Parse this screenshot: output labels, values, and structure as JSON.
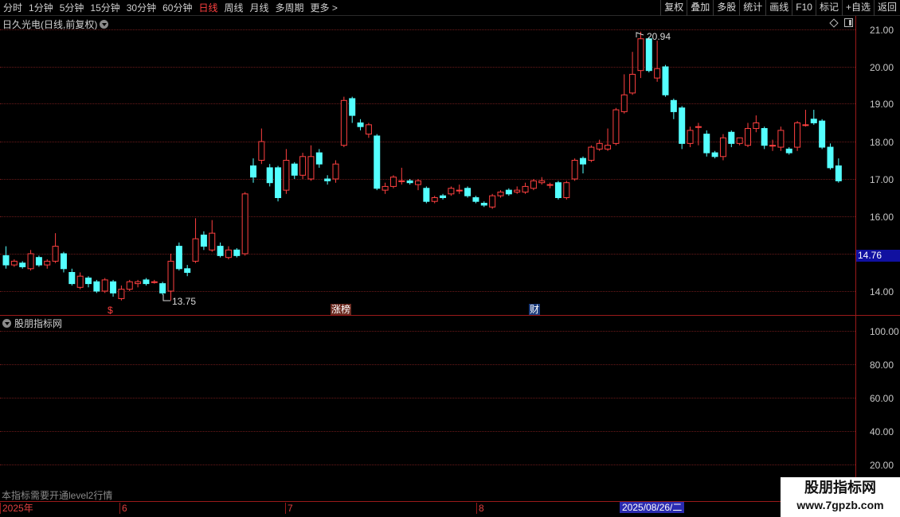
{
  "toolbar": {
    "period_tabs": [
      "分时",
      "1分钟",
      "5分钟",
      "15分钟",
      "30分钟",
      "60分钟",
      "日线",
      "周线",
      "月线",
      "多周期",
      "更多 >"
    ],
    "active_tab": "日线",
    "right_buttons": [
      "复权",
      "叠加",
      "多股",
      "统计",
      "画线",
      "F10",
      "标记",
      "+自选",
      "返回"
    ]
  },
  "main_panel": {
    "title": "日久光电(日线,前复权)",
    "y_labels": [
      "21.00",
      "20.00",
      "19.00",
      "18.00",
      "17.00",
      "16.00",
      "14.00"
    ],
    "current_price": "14.76",
    "max_annotation": "20.94",
    "min_annotation": "13.75",
    "markers": {
      "s": "$",
      "zhang": "涨榜",
      "cai": "财"
    }
  },
  "indicator_panel": {
    "title": "股朋指标网",
    "y_labels": [
      "100.00",
      "80.00",
      "60.00",
      "40.00",
      "20.00"
    ],
    "notice": "本指标需要开通level2行情"
  },
  "date_axis": {
    "labels": [
      "2025年",
      "6",
      "7",
      "8"
    ],
    "cursor_date": "2025/08/26/二"
  },
  "watermark": {
    "title": "股朋指标网",
    "url": "www.7gpzb.com"
  },
  "colors": {
    "up": "#ff4040",
    "down": "#54ffff",
    "grid": "#6a1a1a",
    "axis": "#9a1a1a",
    "active_tab": "#ff4040"
  },
  "chart_data": {
    "type": "candlestick",
    "y_range": [
      13.5,
      21.3
    ],
    "y_ticks": [
      14,
      15,
      16,
      17,
      18,
      19,
      20,
      21
    ],
    "candles": [
      [
        14.95,
        14.7,
        15.2,
        14.6
      ],
      [
        14.7,
        14.8,
        14.85,
        14.65
      ],
      [
        14.75,
        14.65,
        14.8,
        14.6
      ],
      [
        14.6,
        15.0,
        15.1,
        14.55
      ],
      [
        14.9,
        14.7,
        14.95,
        14.65
      ],
      [
        14.7,
        14.8,
        14.85,
        14.6
      ],
      [
        14.8,
        15.2,
        15.55,
        14.75
      ],
      [
        15.0,
        14.6,
        15.05,
        14.5
      ],
      [
        14.5,
        14.2,
        14.6,
        14.15
      ],
      [
        14.1,
        14.4,
        14.5,
        14.05
      ],
      [
        14.35,
        14.2,
        14.4,
        14.1
      ],
      [
        14.25,
        14.0,
        14.3,
        13.95
      ],
      [
        14.0,
        14.3,
        14.35,
        13.95
      ],
      [
        14.25,
        13.95,
        14.3,
        13.85
      ],
      [
        13.8,
        14.05,
        14.15,
        13.75
      ],
      [
        14.05,
        14.25,
        14.3,
        14.0
      ],
      [
        14.2,
        14.25,
        14.3,
        14.1
      ],
      [
        14.3,
        14.2,
        14.35,
        14.15
      ],
      [
        14.25,
        14.25,
        14.3,
        14.2
      ],
      [
        14.2,
        13.95,
        14.25,
        13.9
      ],
      [
        14.0,
        14.8,
        15.0,
        13.75
      ],
      [
        15.2,
        14.6,
        15.3,
        14.55
      ],
      [
        14.6,
        14.5,
        14.7,
        14.4
      ],
      [
        14.8,
        15.4,
        15.95,
        14.75
      ],
      [
        15.5,
        15.2,
        15.6,
        15.1
      ],
      [
        15.1,
        15.55,
        15.9,
        15.05
      ],
      [
        15.2,
        14.95,
        15.3,
        14.9
      ],
      [
        14.9,
        15.1,
        15.2,
        14.85
      ],
      [
        15.1,
        14.95,
        15.15,
        14.9
      ],
      [
        15.0,
        16.6,
        16.65,
        14.95
      ],
      [
        17.35,
        17.05,
        17.55,
        16.9
      ],
      [
        17.5,
        18.0,
        18.35,
        17.4
      ],
      [
        17.3,
        16.9,
        17.4,
        16.8
      ],
      [
        17.3,
        16.5,
        17.35,
        16.4
      ],
      [
        16.7,
        17.5,
        17.8,
        16.6
      ],
      [
        17.4,
        17.1,
        17.45,
        17.0
      ],
      [
        17.1,
        17.6,
        17.7,
        17.0
      ],
      [
        17.0,
        17.6,
        17.9,
        16.95
      ],
      [
        17.7,
        17.4,
        17.8,
        17.3
      ],
      [
        17.0,
        16.95,
        17.1,
        16.85
      ],
      [
        17.0,
        17.4,
        17.5,
        16.9
      ],
      [
        17.9,
        19.1,
        19.2,
        17.85
      ],
      [
        19.15,
        18.7,
        19.2,
        18.5
      ],
      [
        18.5,
        18.4,
        18.6,
        18.3
      ],
      [
        18.2,
        18.45,
        18.5,
        18.1
      ],
      [
        18.15,
        16.75,
        18.2,
        16.7
      ],
      [
        16.7,
        16.8,
        16.9,
        16.6
      ],
      [
        16.8,
        17.05,
        17.1,
        16.75
      ],
      [
        16.95,
        16.95,
        17.3,
        16.85
      ],
      [
        16.95,
        16.9,
        17.0,
        16.85
      ],
      [
        16.85,
        16.95,
        17.0,
        16.7
      ],
      [
        16.75,
        16.4,
        16.8,
        16.35
      ],
      [
        16.4,
        16.5,
        16.55,
        16.35
      ],
      [
        16.55,
        16.5,
        16.6,
        16.45
      ],
      [
        16.6,
        16.75,
        16.8,
        16.55
      ],
      [
        16.7,
        16.7,
        16.85,
        16.6
      ],
      [
        16.75,
        16.55,
        16.8,
        16.5
      ],
      [
        16.5,
        16.4,
        16.55,
        16.35
      ],
      [
        16.35,
        16.3,
        16.4,
        16.25
      ],
      [
        16.25,
        16.55,
        16.6,
        16.2
      ],
      [
        16.55,
        16.65,
        16.7,
        16.5
      ],
      [
        16.7,
        16.6,
        16.75,
        16.55
      ],
      [
        16.65,
        16.7,
        16.8,
        16.6
      ],
      [
        16.65,
        16.8,
        16.9,
        16.6
      ],
      [
        16.75,
        16.95,
        17.0,
        16.7
      ],
      [
        16.9,
        16.95,
        17.05,
        16.85
      ],
      [
        16.85,
        16.85,
        16.9,
        16.75
      ],
      [
        16.9,
        16.5,
        16.95,
        16.45
      ],
      [
        16.5,
        16.9,
        16.95,
        16.45
      ],
      [
        17.0,
        17.5,
        17.55,
        16.95
      ],
      [
        17.55,
        17.4,
        17.6,
        17.15
      ],
      [
        17.5,
        17.85,
        17.9,
        17.45
      ],
      [
        17.8,
        17.95,
        18.05,
        17.75
      ],
      [
        17.8,
        17.9,
        18.35,
        17.75
      ],
      [
        17.95,
        18.85,
        18.9,
        17.9
      ],
      [
        18.8,
        19.25,
        19.8,
        18.75
      ],
      [
        19.3,
        19.8,
        20.4,
        19.25
      ],
      [
        19.9,
        20.75,
        20.94,
        19.7
      ],
      [
        20.75,
        19.9,
        20.8,
        19.85
      ],
      [
        19.7,
        19.95,
        20.7,
        19.6
      ],
      [
        20.0,
        19.25,
        20.05,
        19.2
      ],
      [
        19.1,
        18.8,
        19.15,
        18.6
      ],
      [
        18.9,
        17.95,
        18.95,
        17.8
      ],
      [
        17.95,
        18.3,
        18.4,
        17.85
      ],
      [
        18.4,
        18.4,
        18.5,
        17.9
      ],
      [
        18.2,
        17.7,
        18.3,
        17.6
      ],
      [
        17.7,
        17.6,
        17.75,
        17.55
      ],
      [
        17.6,
        18.1,
        18.2,
        17.5
      ],
      [
        18.25,
        17.95,
        18.3,
        17.85
      ],
      [
        17.95,
        18.1,
        18.1,
        17.9
      ],
      [
        17.9,
        18.35,
        18.5,
        17.85
      ],
      [
        18.35,
        18.5,
        18.7,
        18.25
      ],
      [
        18.35,
        17.9,
        18.4,
        17.8
      ],
      [
        17.9,
        17.9,
        18.05,
        17.75
      ],
      [
        17.85,
        18.3,
        18.4,
        17.75
      ],
      [
        17.8,
        17.7,
        17.85,
        17.65
      ],
      [
        17.85,
        18.5,
        18.55,
        17.75
      ],
      [
        18.45,
        18.45,
        18.85,
        18.4
      ],
      [
        18.6,
        18.5,
        18.85,
        18.45
      ],
      [
        18.55,
        17.85,
        18.6,
        17.8
      ],
      [
        17.85,
        17.3,
        17.95,
        17.25
      ],
      [
        17.35,
        16.95,
        17.55,
        16.9
      ]
    ]
  }
}
